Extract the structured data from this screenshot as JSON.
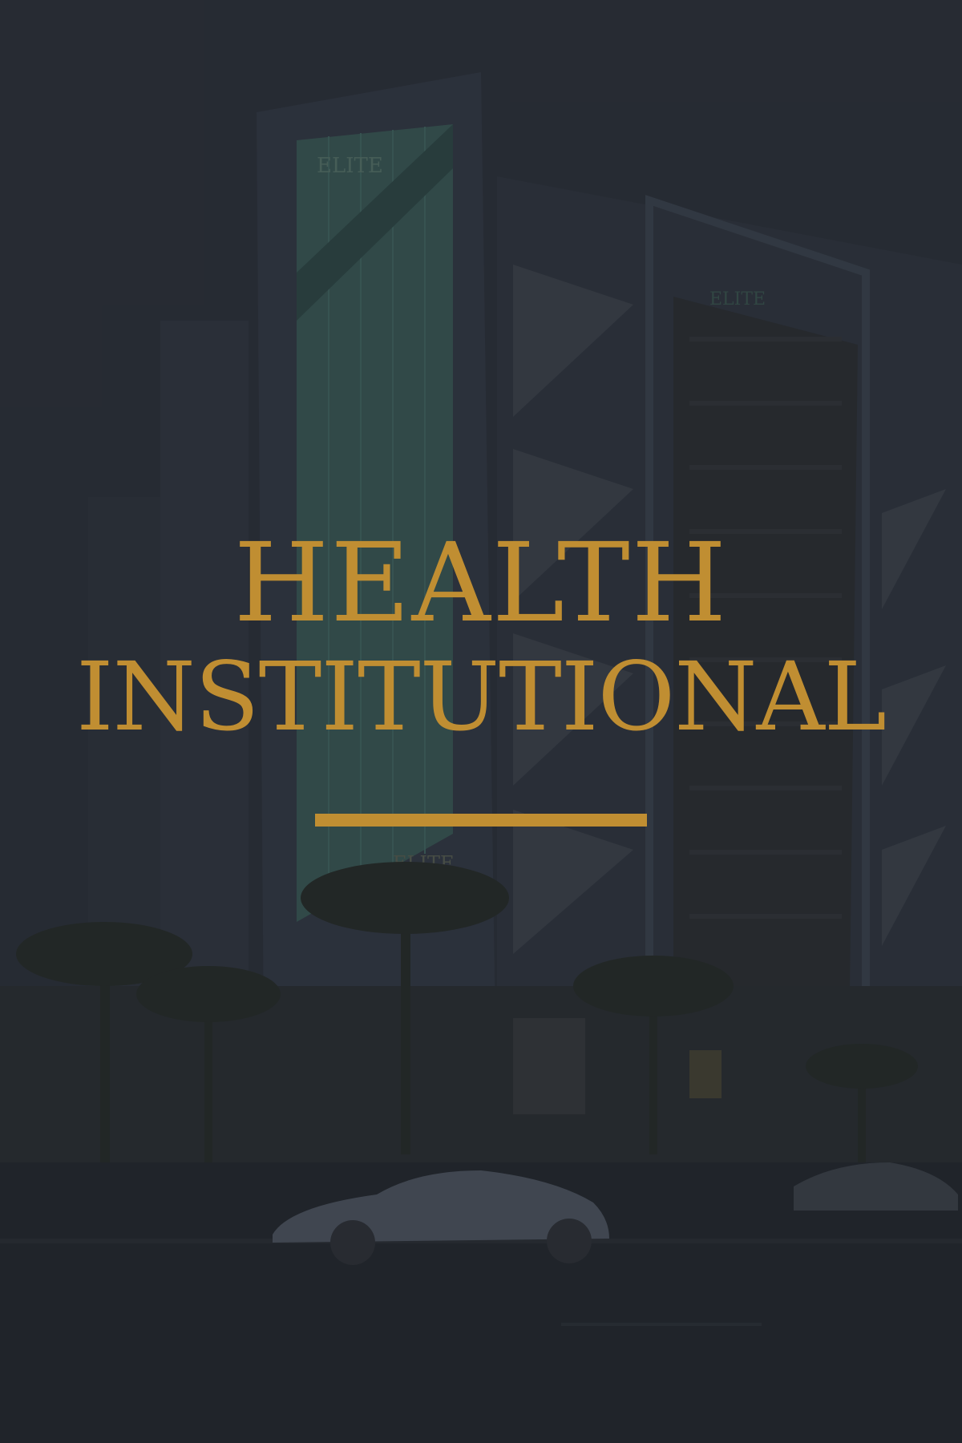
{
  "hero": {
    "title_line_1": "HEALTH",
    "title_line_2": "INSTITUTIONAL",
    "accent_color": "#c08e32"
  },
  "background": {
    "building_sign_1": "ELITE",
    "building_sign_2": "ELITE",
    "building_sign_3": "ELITE"
  }
}
